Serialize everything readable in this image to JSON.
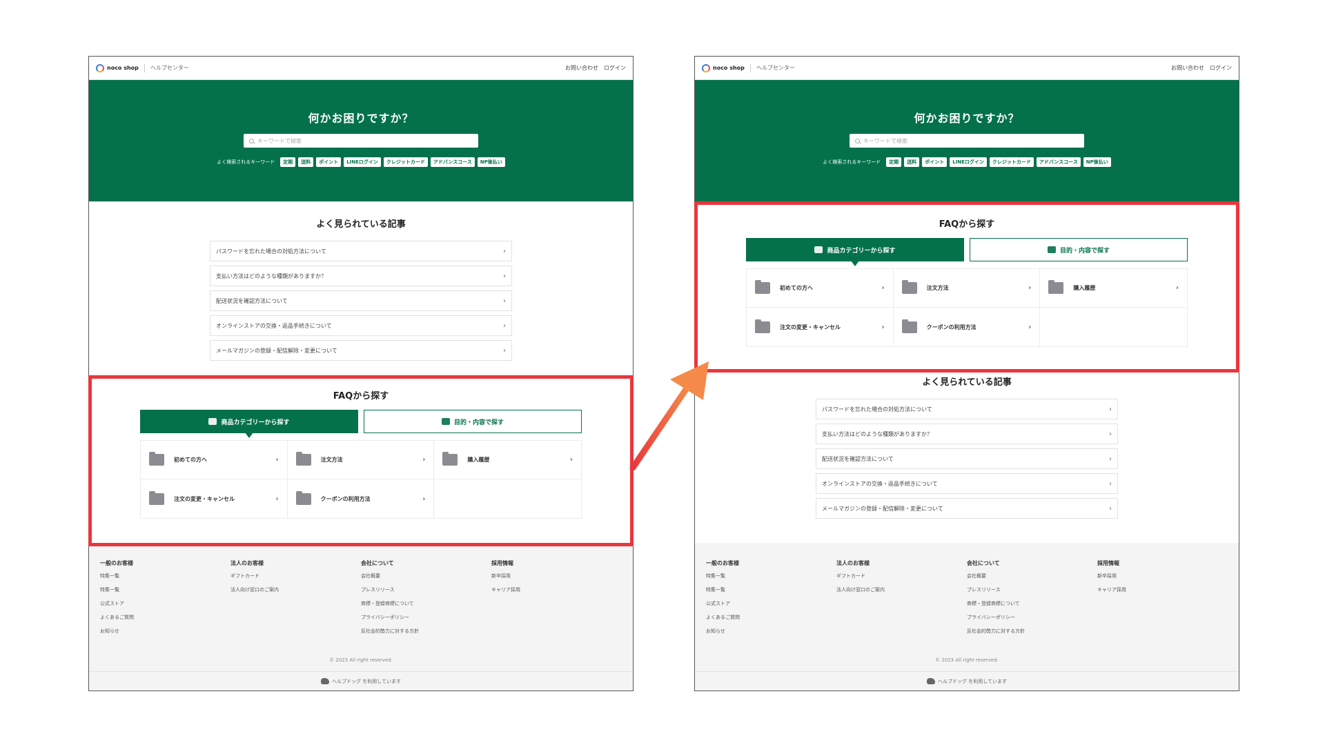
{
  "site": {
    "logo_text": "noco shop",
    "help_center": "ヘルプセンター",
    "contact": "お問い合わせ",
    "login": "ログイン"
  },
  "hero": {
    "title": "何かお困りですか？",
    "search_placeholder": "キーワードで検索",
    "keywords_label": "よく検索されるキーワード",
    "keywords": [
      "定期",
      "送料",
      "ポイント",
      "LINEログイン",
      "クレジットカード",
      "アドバンスコース",
      "NP後払い"
    ]
  },
  "popular": {
    "title": "よく見られている記事",
    "articles": [
      "パスワードを忘れた場合の対処方法について",
      "支払い方法はどのような種類がありますか？",
      "配送状況を確認方法について",
      "オンラインストアの交換・返品手続きについて",
      "メールマガジンの登録・配信解除・変更について"
    ]
  },
  "faq": {
    "title": "FAQから探す",
    "tab_category": "商品カテゴリーから探す",
    "tab_purpose": "目的・内容で探す",
    "categories": [
      "初めての方へ",
      "注文方法",
      "購入履歴",
      "注文の変更・キャンセル",
      "クーポンの利用方法"
    ]
  },
  "footer": {
    "columns": [
      {
        "title": "一般のお客様",
        "items": [
          "特集一覧",
          "特集一覧",
          "公式ストア",
          "よくあるご質問",
          "お知らせ"
        ]
      },
      {
        "title": "法人のお客様",
        "items": [
          "ギフトカード",
          "法人向け窓口のご案内"
        ]
      },
      {
        "title": "会社について",
        "items": [
          "会社概要",
          "プレスリリース",
          "商標・登録商標について",
          "プライバシーポリシー",
          "反社会的勢力に対する方針"
        ]
      },
      {
        "title": "採用情報",
        "items": [
          "新卒採用",
          "キャリア採用"
        ]
      }
    ],
    "copyright": "© 2023 All right reserved.",
    "powered": "ヘルプドッグ を利用しています"
  },
  "colors": {
    "brand_green": "#04714b",
    "highlight_red": "#e8373c",
    "arrow_orange": "#f58a4a"
  }
}
